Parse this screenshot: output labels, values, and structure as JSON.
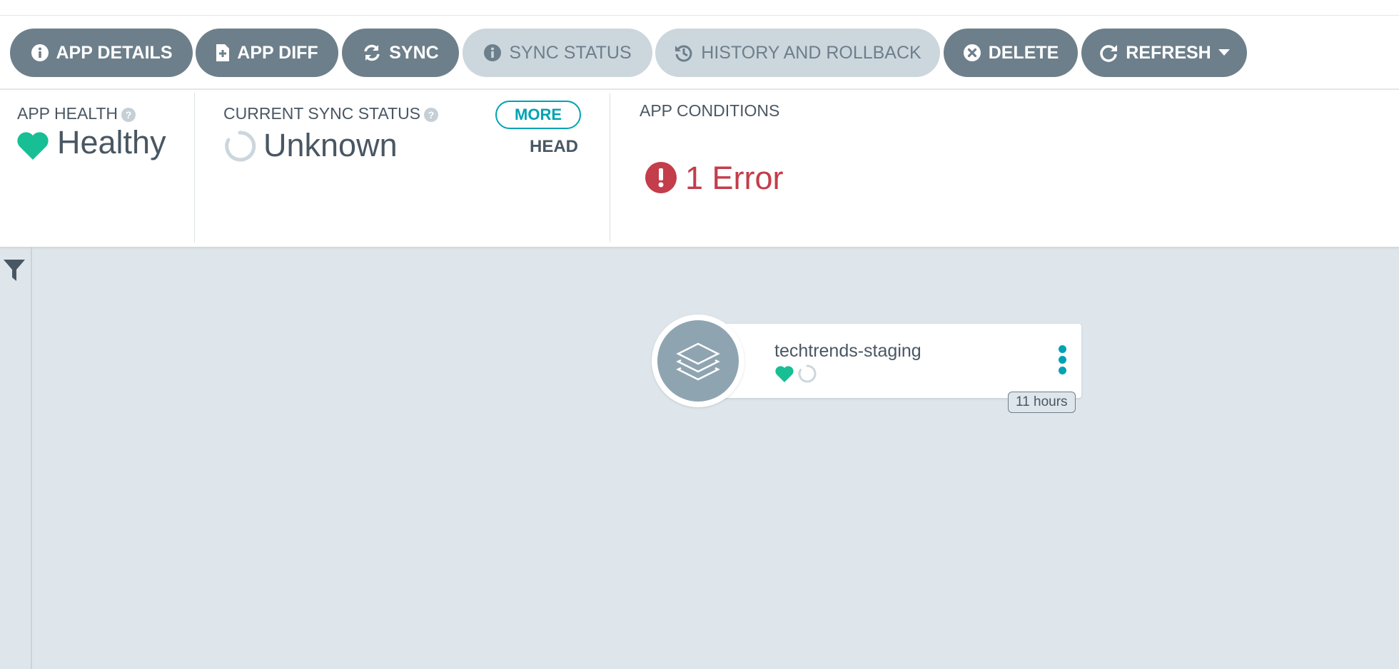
{
  "toolbar": {
    "app_details": "APP DETAILS",
    "app_diff": "APP DIFF",
    "sync": "SYNC",
    "sync_status": "SYNC STATUS",
    "history": "HISTORY AND ROLLBACK",
    "delete": "DELETE",
    "refresh": "REFRESH"
  },
  "status": {
    "health_label": "APP HEALTH",
    "health_value": "Healthy",
    "sync_label": "CURRENT SYNC STATUS",
    "sync_value": "Unknown",
    "more": "MORE",
    "revision": "HEAD",
    "conditions_label": "APP CONDITIONS",
    "conditions_value": "1 Error"
  },
  "graph": {
    "node": {
      "name": "techtrends-staging",
      "age": "11 hours"
    }
  },
  "colors": {
    "button_bg": "#6d7f8b",
    "button_disabled_bg": "#ccd6dd",
    "healthy": "#18be94",
    "error": "#c33d4a",
    "accent": "#00a2b3",
    "canvas_bg": "#dee6eb"
  },
  "icons": [
    "info-icon",
    "file-diff-icon",
    "sync-icon",
    "history-icon",
    "delete-icon",
    "refresh-icon",
    "caret-down-icon",
    "question-icon",
    "heart-icon",
    "circle-notch-icon",
    "error-icon",
    "filter-icon",
    "layers-icon",
    "kebab-menu-icon"
  ]
}
